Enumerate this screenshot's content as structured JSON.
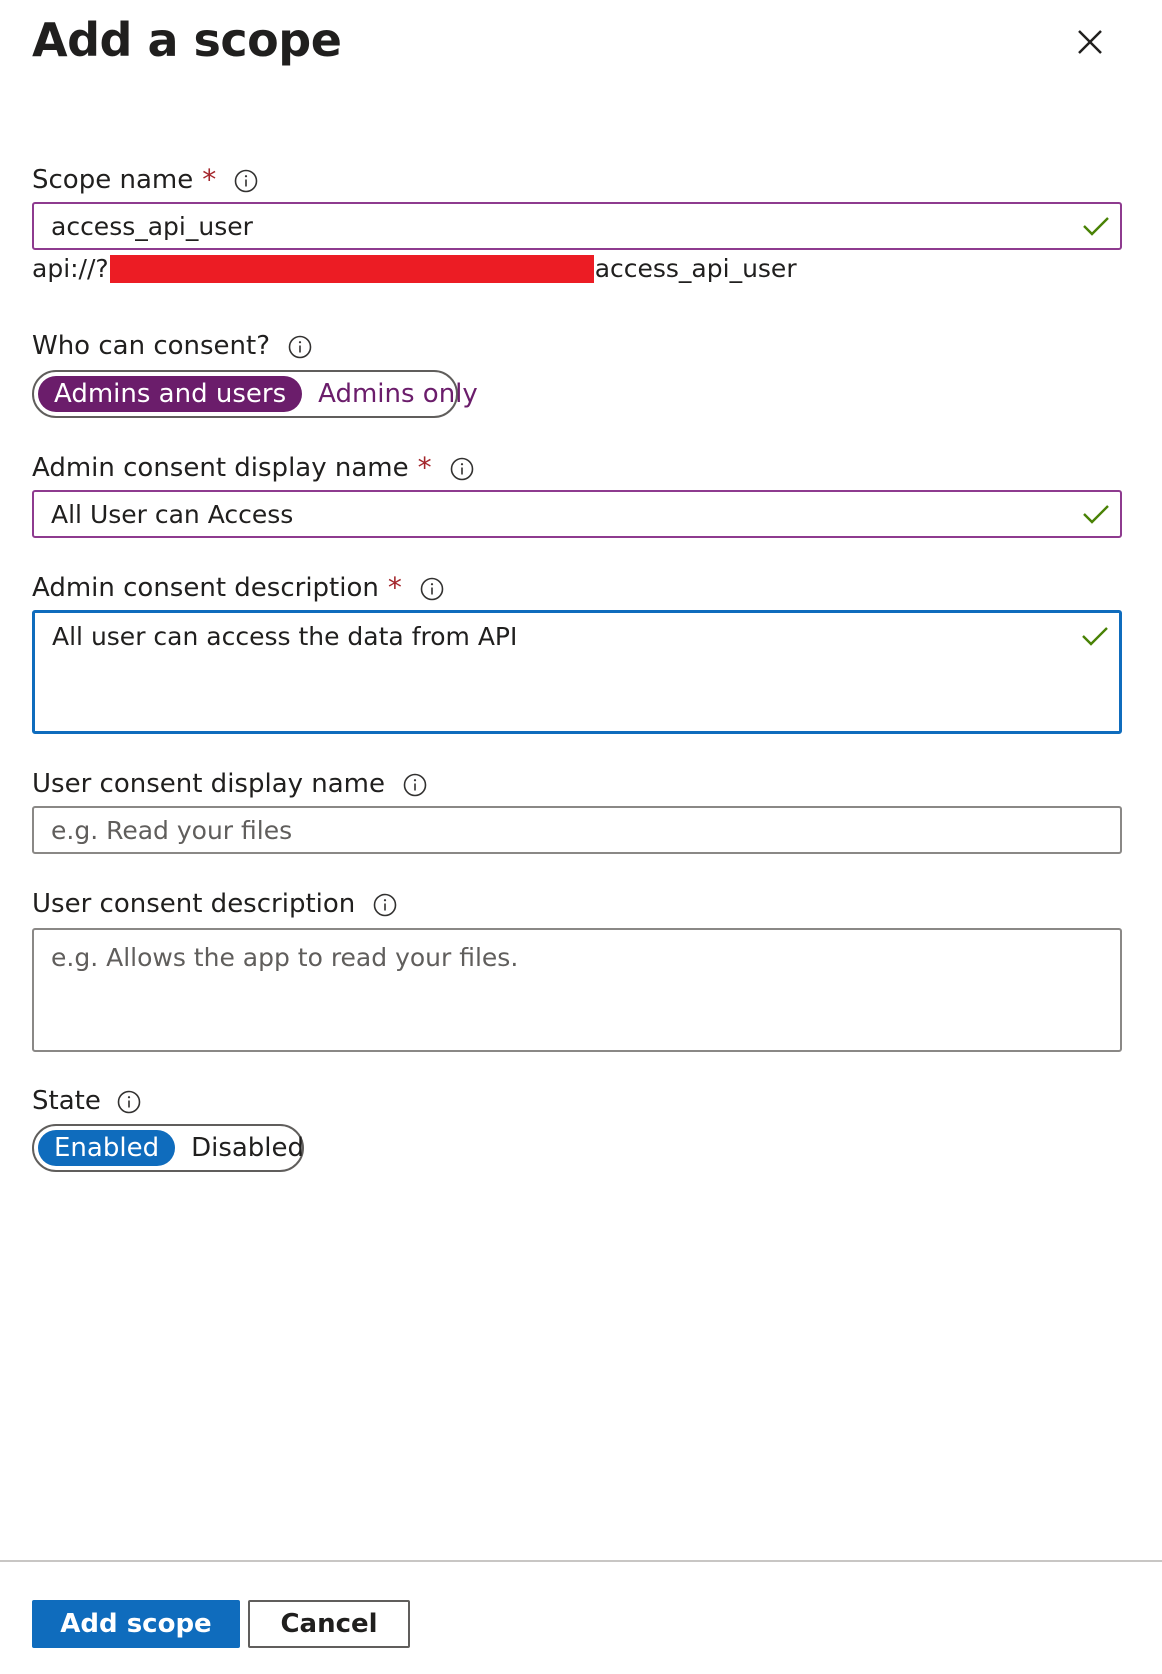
{
  "panel": {
    "title": "Add a scope"
  },
  "scope_name": {
    "label": "Scope name",
    "required_mark": "*",
    "value": "access_api_user",
    "uri_prefix": "api://?",
    "uri_suffix": "access_api_user"
  },
  "who_can_consent": {
    "label": "Who can consent?",
    "options": [
      "Admins and users",
      "Admins only"
    ],
    "selected": "Admins and users"
  },
  "admin_consent_display_name": {
    "label": "Admin consent display name",
    "required_mark": "*",
    "value": "All User can Access"
  },
  "admin_consent_description": {
    "label": "Admin consent description",
    "required_mark": "*",
    "value": "All user can access the data from API"
  },
  "user_consent_display_name": {
    "label": "User consent display name",
    "placeholder": "e.g. Read your files"
  },
  "user_consent_description": {
    "label": "User consent description",
    "placeholder": "e.g. Allows the app to read your files."
  },
  "state": {
    "label": "State",
    "options": [
      "Enabled",
      "Disabled"
    ],
    "selected": "Enabled"
  },
  "footer": {
    "add_label": "Add scope",
    "cancel_label": "Cancel"
  },
  "colors": {
    "accent_blue": "#0f6cbd",
    "accent_purple": "#6b1d6b",
    "valid_border": "#8e3b8f",
    "check_green": "#498205",
    "required_red": "#a4262c"
  },
  "icons": {
    "close": "close-icon",
    "info": "info-icon",
    "valid": "checkmark-icon"
  }
}
